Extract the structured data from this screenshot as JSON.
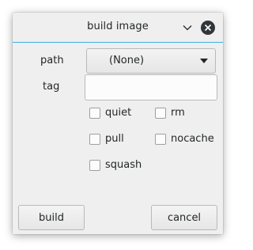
{
  "window": {
    "title": "build image"
  },
  "form": {
    "path_label": "path",
    "path_value": "(None)",
    "tag_label": "tag",
    "tag_value": "",
    "options": [
      {
        "label": "quiet",
        "checked": false
      },
      {
        "label": "rm",
        "checked": false
      },
      {
        "label": "pull",
        "checked": false
      },
      {
        "label": "nocache",
        "checked": false
      },
      {
        "label": "squash",
        "checked": false
      }
    ]
  },
  "buttons": {
    "build_label": "build",
    "cancel_label": "cancel"
  },
  "icons": {
    "minimize": "chevron-down-icon",
    "close": "close-icon",
    "dropdown": "triangle-down-icon"
  },
  "colors": {
    "accent": "#3daee9",
    "window_bg": "#efefef",
    "close_bg": "#31363b"
  }
}
